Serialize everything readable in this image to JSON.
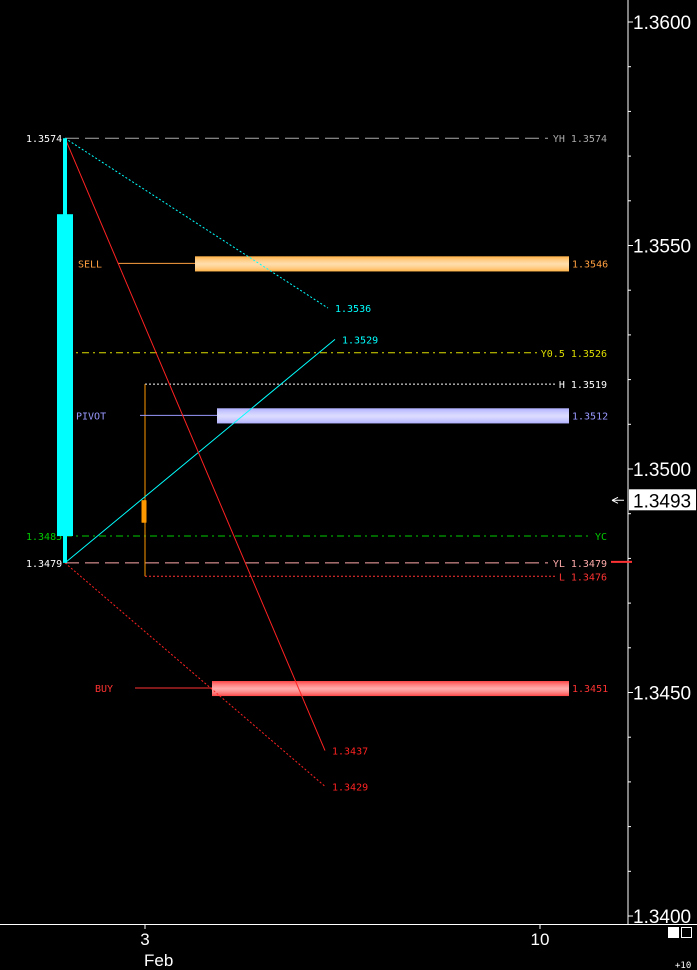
{
  "chart_data": {
    "type": "candlestick",
    "price_axis": {
      "ticks": [
        "1.3600",
        "1.3550",
        "1.3500",
        "1.3450",
        "1.3400"
      ],
      "current_price": "1.3493",
      "range": [
        1.3398,
        1.3612
      ]
    },
    "time_axis": {
      "ticks": [
        "3",
        "10"
      ],
      "month_label": "Feb",
      "zoom_label": "+10"
    },
    "candles": [
      {
        "open": 1.3485,
        "high": 1.3574,
        "low": 1.3479,
        "close": 1.3557,
        "color": "#00ffff"
      },
      {
        "open": 1.3493,
        "high": 1.3493,
        "low": 1.3488,
        "close": 1.3488,
        "color": "#ff9900"
      }
    ],
    "levels": [
      {
        "name": "YH",
        "text": "YH 1.3574",
        "left_text": "1.3574",
        "price": 1.3574,
        "color": "#aaaaaa",
        "style": "long-dash"
      },
      {
        "name": "Y0.5",
        "text": "Y0.5 1.3526",
        "left_text": "",
        "price": 1.3526,
        "color": "#dddd00",
        "style": "dash-dot"
      },
      {
        "name": "H",
        "text": "H 1.3519",
        "left_text": "",
        "price": 1.3519,
        "color": "#ffffff",
        "style": "dot"
      },
      {
        "name": "YC",
        "text": "YC",
        "left_text": "1.3485",
        "price": 1.3485,
        "color": "#00cc00",
        "style": "dash-dot"
      },
      {
        "name": "YL",
        "text": "YL 1.3479",
        "left_text": "1.3479",
        "price": 1.3479,
        "color": "#ffaaaa",
        "style": "long-dash"
      },
      {
        "name": "L",
        "text": "L 1.3476",
        "left_text": "",
        "price": 1.3476,
        "color": "#ff3333",
        "style": "dot"
      }
    ],
    "zones": [
      {
        "label": "SELL",
        "value_text": "1.3546",
        "price": 1.3546,
        "color": "#ffb347",
        "label_color": "#ffa040"
      },
      {
        "label": "PIVOT",
        "value_text": "1.3512",
        "price": 1.3512,
        "color": "#b0b0ff",
        "label_color": "#9999ff"
      },
      {
        "label": "BUY",
        "value_text": "1.3451",
        "price": 1.3451,
        "color": "#ff4444",
        "label_color": "#ff3333"
      }
    ],
    "projections": [
      {
        "from_price": 1.3574,
        "to_price": 1.3536,
        "label": "1.3536",
        "color": "#00ffff",
        "style": "dot"
      },
      {
        "from_price": 1.3479,
        "to_price": 1.3529,
        "label": "1.3529",
        "color": "#00ffff",
        "style": "solid"
      },
      {
        "from_price": 1.3574,
        "to_price": 1.3437,
        "label": "1.3437",
        "color": "#ff2222",
        "style": "solid"
      },
      {
        "from_price": 1.3479,
        "to_price": 1.3429,
        "label": "1.3429",
        "color": "#ff2222",
        "style": "dot"
      }
    ]
  }
}
